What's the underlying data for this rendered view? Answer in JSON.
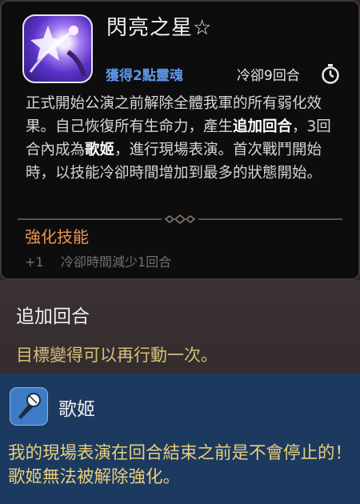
{
  "skill": {
    "name": "閃亮之星☆",
    "soul_gain": "獲得2點靈魂",
    "cooldown": "冷卻9回合",
    "description": {
      "p1": "正式開始公演之前解除全體我軍的所有弱化效果。自己恢復所有生命力，產生",
      "k1": "追加回合",
      "p2": "，3回合內成為",
      "k2": "歌姬",
      "p3": "，進行現場表演。首次戰鬥開始時，以技能冷卻時間增加到最多的狀態開始。"
    }
  },
  "enhance": {
    "title": "強化技能",
    "level": "+1",
    "effect": "冷卻時間減少1回合"
  },
  "keywords": {
    "bonus_turn": {
      "title": "追加回合",
      "desc": "目標變得可以再行動一次。"
    },
    "idol": {
      "title": "歌姬",
      "desc": "我的現場表演在回合結束之前是不會停止的！歌姬無法被解除強化。"
    }
  },
  "colors": {
    "soul": "#5d96e6",
    "enhance": "#f0924f",
    "keyword_desc": "#d4c07a",
    "idol_panel": "#1c3a5f"
  },
  "icons": {
    "skill": "star-idol-skill-icon",
    "cooldown": "stopwatch-icon",
    "idol": "microphone-icon"
  }
}
